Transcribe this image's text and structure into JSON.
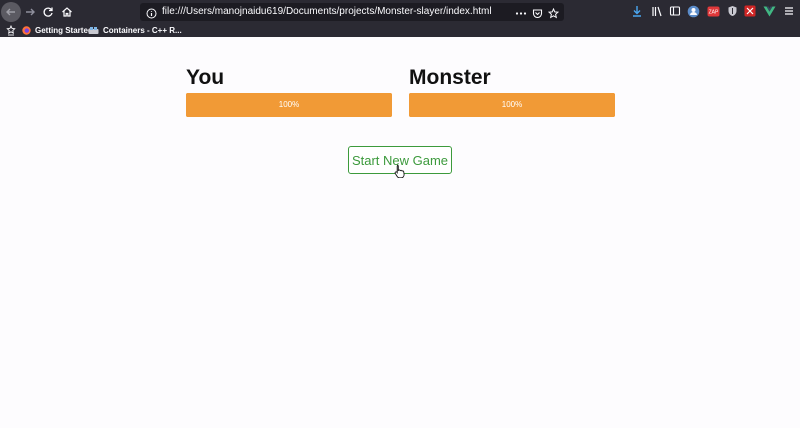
{
  "browser": {
    "url": "file:///Users/manojnaidu619/Documents/projects/Monster-slayer/index.html",
    "bookmarks": [
      {
        "label": "Getting Started",
        "icon": "firefox-icon"
      },
      {
        "label": "Containers - C++ R...",
        "icon": "containers-icon"
      }
    ],
    "toolbar_icons": [
      "back-icon",
      "forward-icon",
      "reload-icon",
      "home-icon",
      "download-icon",
      "library-icon",
      "sidebar-icon",
      "account-icon",
      "extension-red-icon",
      "shield-icon",
      "extension-cross-icon",
      "vue-icon",
      "menu-icon"
    ]
  },
  "game": {
    "player": {
      "title": "You",
      "health_label": "100%",
      "health": 100
    },
    "monster": {
      "title": "Monster",
      "health_label": "100%",
      "health": 100
    },
    "start_button_label": "Start New Game",
    "colors": {
      "health_bar": "#f19a36",
      "start_button": "#3c9a3c"
    }
  }
}
